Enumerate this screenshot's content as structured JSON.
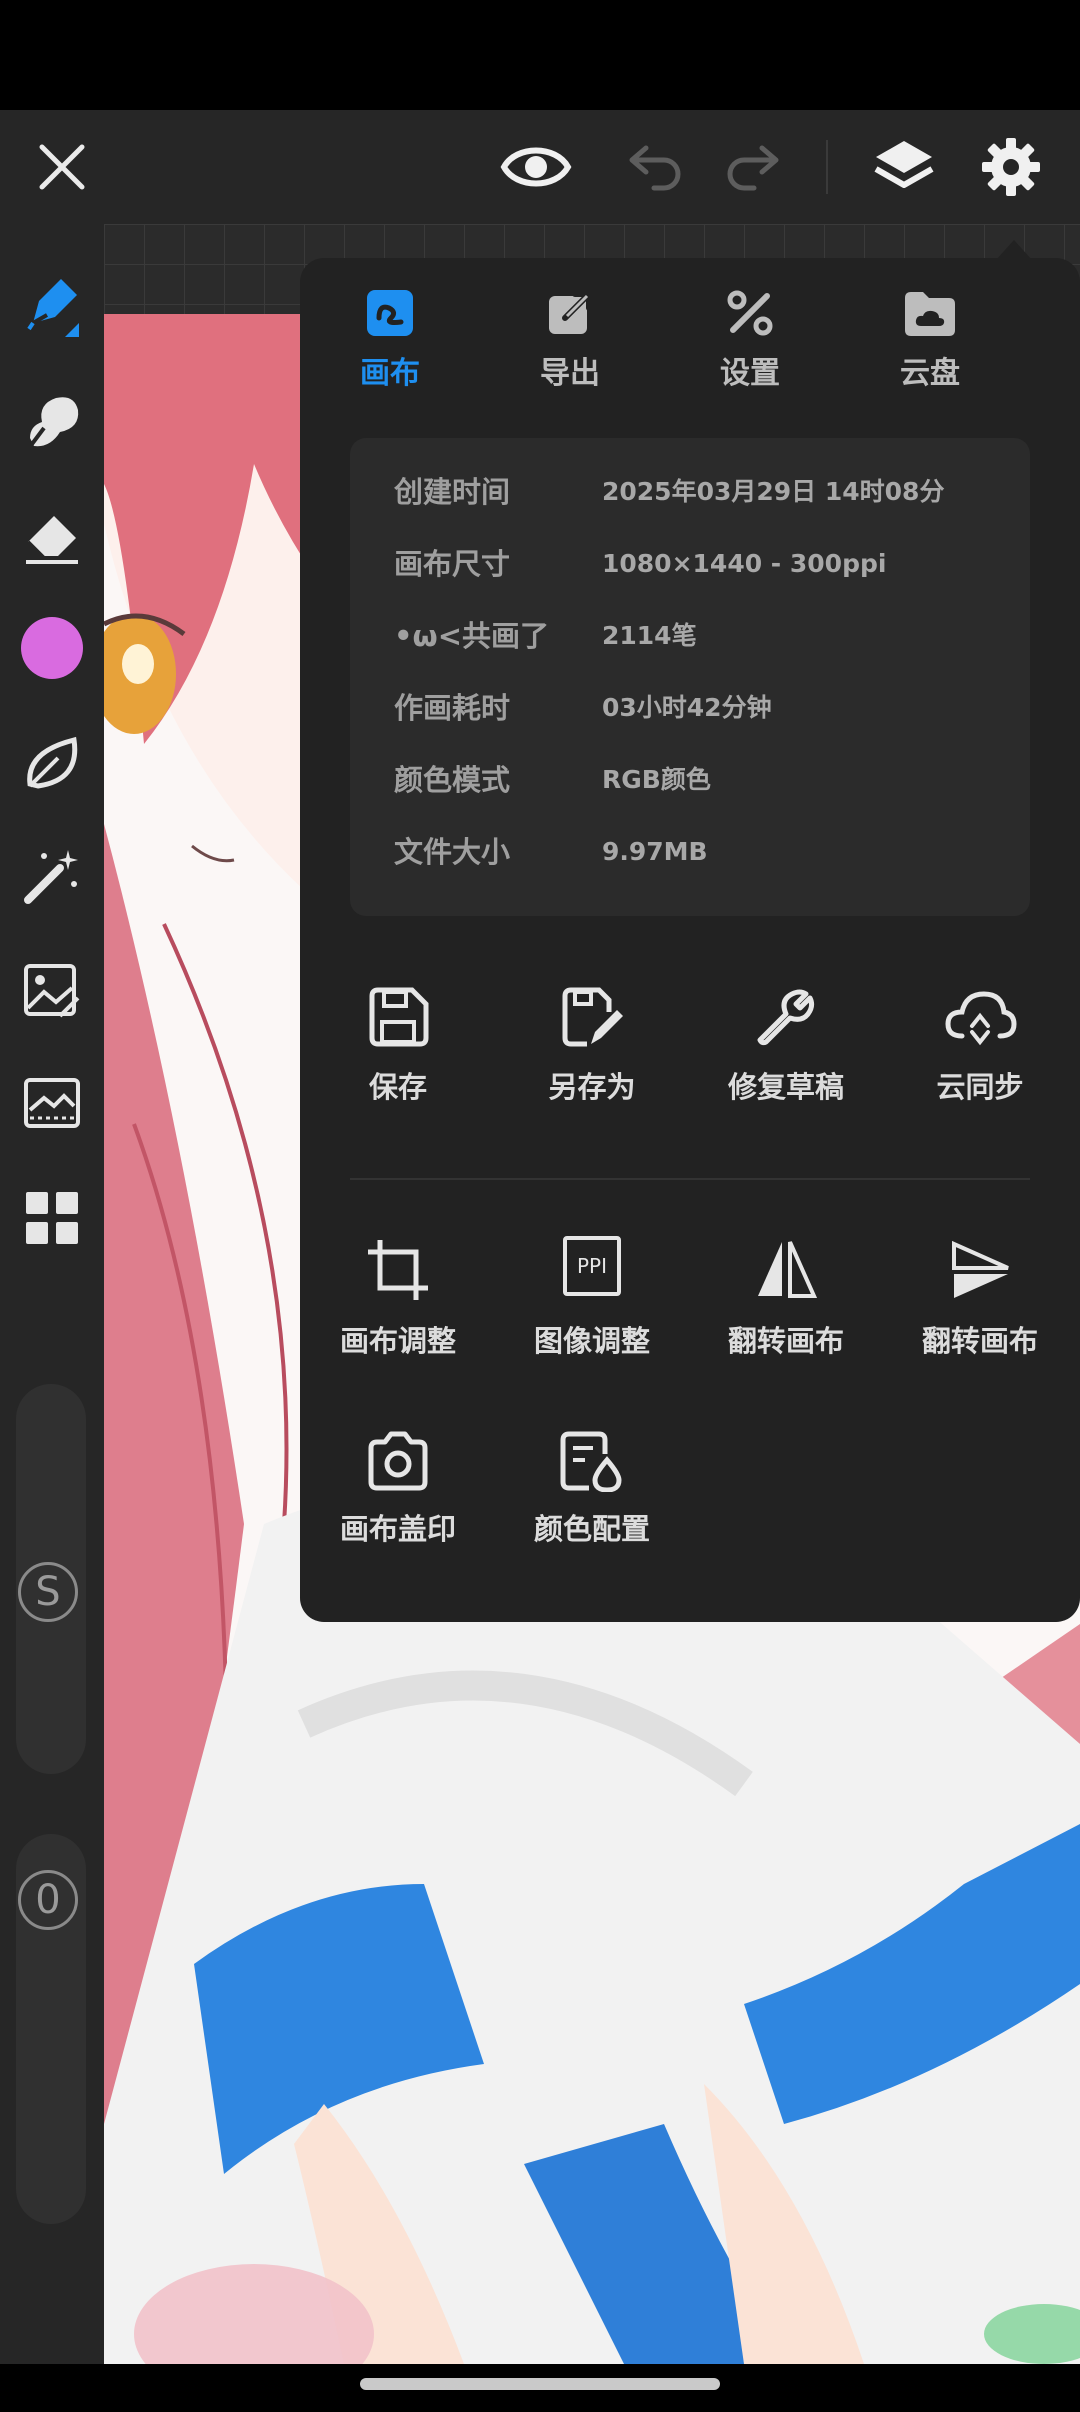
{
  "toolbar": {
    "close_icon": "close-icon",
    "preview_icon": "eye-icon",
    "undo_icon": "undo-icon",
    "redo_icon": "redo-icon",
    "layers_icon": "layers-icon",
    "settings_icon": "gear-icon"
  },
  "left_tools": [
    {
      "name": "brush-icon",
      "active": true
    },
    {
      "name": "smudge-icon"
    },
    {
      "name": "eraser-icon"
    },
    {
      "name": "color-swatch",
      "color": "#d96be0"
    },
    {
      "name": "leaf-icon"
    },
    {
      "name": "magic-wand-icon"
    },
    {
      "name": "image-adjust-icon"
    },
    {
      "name": "reference-icon"
    },
    {
      "name": "grid-apps-icon"
    }
  ],
  "sliders": {
    "size_label": "S",
    "opacity_label": "0"
  },
  "panel": {
    "tabs": [
      {
        "label": "画布",
        "active": true,
        "icon": "canvas-icon"
      },
      {
        "label": "导出",
        "icon": "export-icon"
      },
      {
        "label": "设置",
        "icon": "settings-tools-icon"
      },
      {
        "label": "云盘",
        "icon": "cloud-folder-icon"
      }
    ],
    "info": [
      {
        "key": "创建时间",
        "value": "2025年03月29日  14时08分"
      },
      {
        "key": "画布尺寸",
        "value": "1080×1440  -  300ppi"
      },
      {
        "key": "•ω<共画了",
        "value": "2114笔"
      },
      {
        "key": "作画耗时",
        "value": "03小时42分钟"
      },
      {
        "key": "颜色模式",
        "value": "RGB颜色"
      },
      {
        "key": "文件大小",
        "value": "9.97MB"
      }
    ],
    "actions_row1": [
      {
        "label": "保存",
        "icon": "save-icon"
      },
      {
        "label": "另存为",
        "icon": "save-as-icon"
      },
      {
        "label": "修复草稿",
        "icon": "wrench-icon"
      },
      {
        "label": "云同步",
        "icon": "cloud-sync-icon"
      }
    ],
    "actions_row2": [
      {
        "label": "画布调整",
        "icon": "crop-icon"
      },
      {
        "label": "图像调整",
        "icon": "ppi-icon",
        "icon_text": "PPI"
      },
      {
        "label": "翻转画布",
        "icon": "flip-horizontal-icon"
      },
      {
        "label": "翻转画布",
        "icon": "flip-vertical-icon"
      }
    ],
    "actions_row3": [
      {
        "label": "画布盖印",
        "icon": "camera-icon"
      },
      {
        "label": "颜色配置",
        "icon": "color-profile-icon"
      }
    ]
  },
  "colors": {
    "accent": "#1e8ff0",
    "panel_bg": "#222222",
    "bar_bg": "#262626"
  }
}
